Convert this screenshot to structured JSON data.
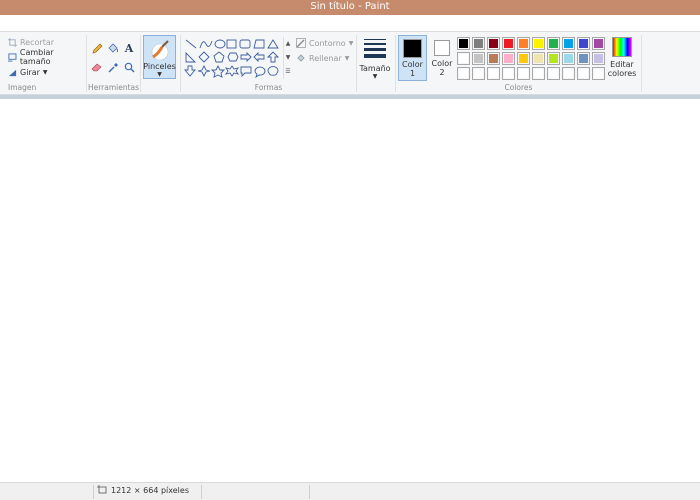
{
  "window": {
    "title": "Sin título - Paint"
  },
  "groups": {
    "imagen": {
      "label": "Imagen",
      "crop": "Recortar",
      "resize": "Cambiar tamaño",
      "rotate": "Girar"
    },
    "herramientas": {
      "label": "Herramientas"
    },
    "pinceles": {
      "label": "Pinceles"
    },
    "formas": {
      "label": "Formas",
      "outline": "Contorno",
      "fill": "Rellenar"
    },
    "tamano": {
      "label": "Tamaño"
    },
    "colores": {
      "label": "Colores",
      "color1_line1": "Color",
      "color1_line2": "1",
      "color2_line1": "Color",
      "color2_line2": "2",
      "edit_line1": "Editar",
      "edit_line2": "colores",
      "color1_value": "#000000",
      "color2_value": "#ffffff",
      "palette_row1": [
        "#000000",
        "#7f7f7f",
        "#880015",
        "#ed1c24",
        "#ff7f27",
        "#fff200",
        "#22b14c",
        "#00a2e8",
        "#3f48cc",
        "#a349a4"
      ],
      "palette_row2": [
        "#ffffff",
        "#c3c3c3",
        "#b97a57",
        "#ffaec9",
        "#ffc90e",
        "#efe4b0",
        "#b5e61d",
        "#99d9ea",
        "#7092be",
        "#c8bfe7"
      ],
      "palette_row3": [
        "#ffffff",
        "#ffffff",
        "#ffffff",
        "#ffffff",
        "#ffffff",
        "#ffffff",
        "#ffffff",
        "#ffffff",
        "#ffffff",
        "#ffffff"
      ]
    }
  },
  "statusbar": {
    "canvas_size": "1212 × 664 píxeles"
  },
  "colors": {
    "titlebar": "#c58b6c",
    "ribbon": "#f5f6f7",
    "selected": "#cfe3f6"
  }
}
